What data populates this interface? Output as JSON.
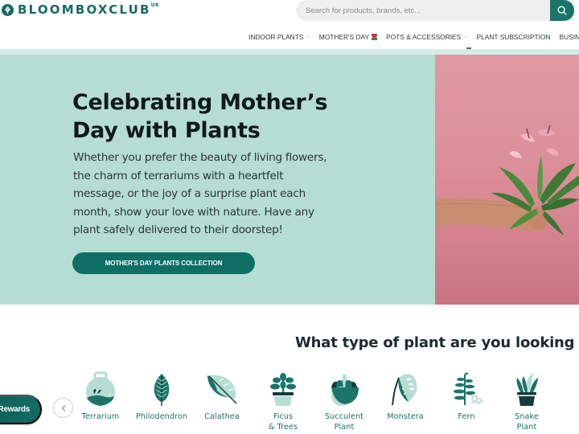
{
  "brand": {
    "name": "BLOOMBOXCLUB",
    "region": "UK",
    "logo_icon": "tree-icon",
    "color_primary": "#176b62",
    "color_hero_bg": "#b6ddd4"
  },
  "search": {
    "placeholder": "Search for products, brands, etc...",
    "value": "",
    "button_icon": "search-icon"
  },
  "nav": {
    "items": [
      {
        "label": "INDOOR PLANTS",
        "has_dropdown": true
      },
      {
        "label": "MOTHER'S DAY",
        "icon": "tulip-icon",
        "has_dropdown": false
      },
      {
        "label": "POTS & ACCESSORIES",
        "has_dropdown": true
      },
      {
        "label": "PLANT SUBSCRIPTION",
        "has_dropdown": false
      },
      {
        "label": "BUSINESSES",
        "has_dropdown": false
      }
    ],
    "chevron": "⌵"
  },
  "hero": {
    "title": "Celebrating Mother’s Day with Plants",
    "body": "Whether you prefer the beauty of living flowers, the charm of terrariums with a heartfelt message, or the joy of a surprise plant each month, show your love with nature. Have any plant safely delivered to their doorstep!",
    "cta_label": "MOTHER'S DAY PLANTS COLLECTION",
    "image_alt": "Arm holding a pink anthurium plant against a pink wall"
  },
  "plant_types": {
    "title": "What type of plant are you looking for?",
    "categories": [
      {
        "label": "Terrarium",
        "icon": "terrarium-icon"
      },
      {
        "label": "Philodendron",
        "icon": "philodendron-leaf-icon"
      },
      {
        "label": "Calathea",
        "icon": "calathea-leaf-icon"
      },
      {
        "label": "Ficus & Trees",
        "icon": "ficus-pot-icon"
      },
      {
        "label": "Succulent Plant",
        "icon": "succulent-icon"
      },
      {
        "label": "Monstera",
        "icon": "monstera-leaf-icon"
      },
      {
        "label": "Fern",
        "icon": "fern-icon"
      },
      {
        "label": "Snake Plant",
        "icon": "snake-plant-icon"
      },
      {
        "label": "",
        "icon": "plant-icon"
      }
    ]
  },
  "rewards": {
    "label": "Rewards"
  },
  "carousel": {
    "prev_icon": "chevron-left-icon"
  }
}
